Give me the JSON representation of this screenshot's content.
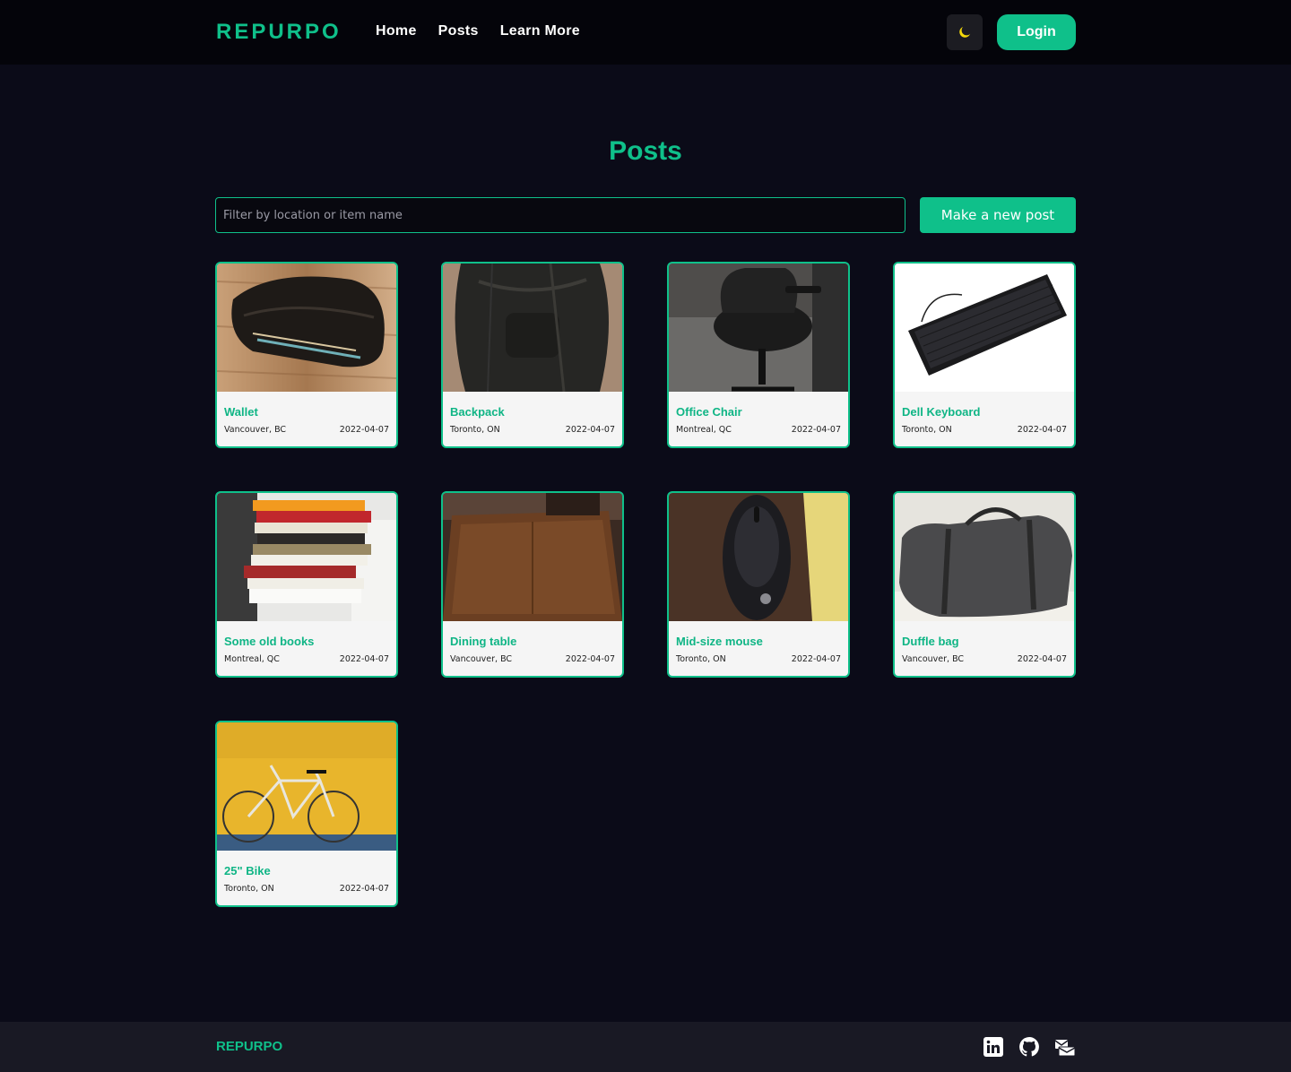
{
  "header": {
    "logo": "REPURPO",
    "nav": [
      "Home",
      "Posts",
      "Learn More"
    ],
    "theme_icon": "moon-icon",
    "login_label": "Login"
  },
  "main": {
    "title": "Posts",
    "search_placeholder": "Filter by location or item name",
    "new_post_label": "Make a new post",
    "posts": [
      {
        "title": "Wallet",
        "location": "Vancouver, BC",
        "date": "2022-04-07"
      },
      {
        "title": "Backpack",
        "location": "Toronto, ON",
        "date": "2022-04-07"
      },
      {
        "title": "Office Chair",
        "location": "Montreal, QC",
        "date": "2022-04-07"
      },
      {
        "title": "Dell Keyboard",
        "location": "Toronto, ON",
        "date": "2022-04-07"
      },
      {
        "title": "Some old books",
        "location": "Montreal, QC",
        "date": "2022-04-07"
      },
      {
        "title": "Dining table",
        "location": "Vancouver, BC",
        "date": "2022-04-07"
      },
      {
        "title": "Mid-size mouse",
        "location": "Toronto, ON",
        "date": "2022-04-07"
      },
      {
        "title": "Duffle bag",
        "location": "Vancouver, BC",
        "date": "2022-04-07"
      },
      {
        "title": "25\" Bike",
        "location": "Toronto, ON",
        "date": "2022-04-07"
      }
    ]
  },
  "footer": {
    "logo": "REPURPO",
    "icons": [
      "linkedin-icon",
      "github-icon",
      "email-icon"
    ]
  },
  "colors": {
    "accent": "#0fc08a",
    "background": "#0b0b18",
    "header_bg": "#04040a",
    "footer_bg": "#191924",
    "card_bg": "#f5f5f5"
  }
}
